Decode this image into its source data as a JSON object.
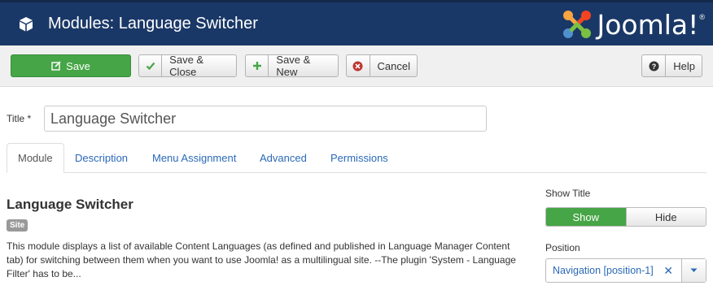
{
  "header": {
    "title": "Modules: Language Switcher",
    "logo_text": "Joomla!",
    "logo_reg": "®"
  },
  "toolbar": {
    "save_label": "Save",
    "save_close_label": "Save & Close",
    "save_new_label": "Save & New",
    "cancel_label": "Cancel",
    "help_label": "Help"
  },
  "form": {
    "title_label": "Title *",
    "title_value": "Language Switcher"
  },
  "tabs": [
    {
      "label": "Module"
    },
    {
      "label": "Description"
    },
    {
      "label": "Menu Assignment"
    },
    {
      "label": "Advanced"
    },
    {
      "label": "Permissions"
    }
  ],
  "module": {
    "name": "Language Switcher",
    "badge": "Site",
    "description": "This module displays a list of available Content Languages (as defined and published in Language Manager Content tab) for switching between them when you want to use Joomla! as a multilingual site. --The plugin 'System - Language Filter' has to be..."
  },
  "sidebar": {
    "show_title_label": "Show Title",
    "show_label": "Show",
    "hide_label": "Hide",
    "position_label": "Position",
    "position_value": "Navigation [position-1]"
  },
  "colors": {
    "header_bg": "#1a3867",
    "save_green": "#46a546",
    "link_blue": "#2a69b8"
  }
}
